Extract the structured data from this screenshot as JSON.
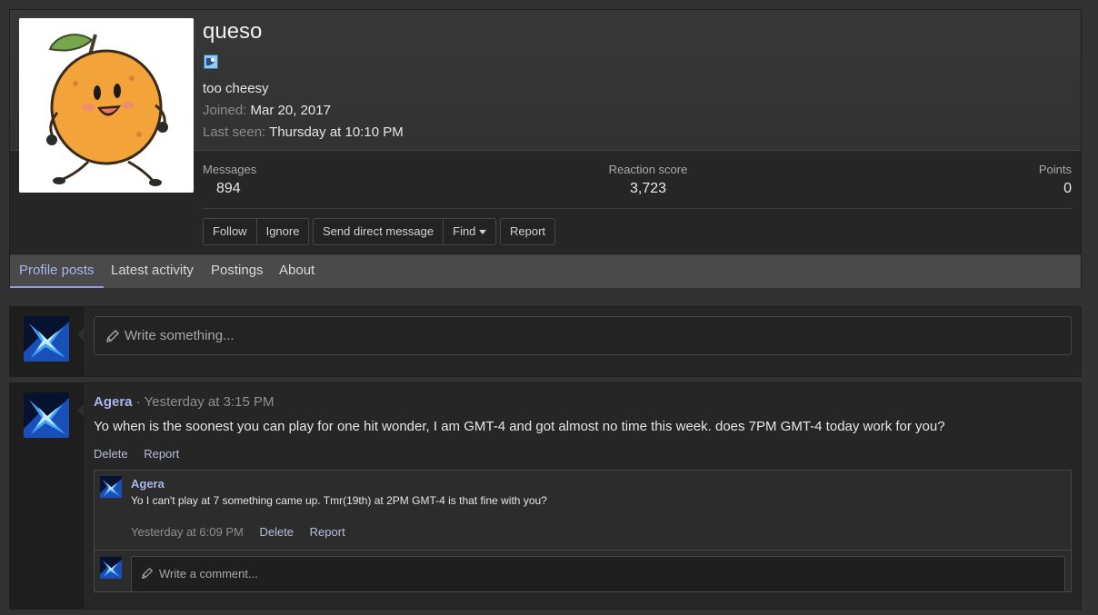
{
  "profile": {
    "username": "queso",
    "status": "too cheesy",
    "joined_label": "Joined:",
    "joined_value": "Mar 20, 2017",
    "last_seen_label": "Last seen:",
    "last_seen_value": "Thursday at 10:10 PM",
    "avatar_icon": "orange-mascot-icon"
  },
  "stats": {
    "messages_label": "Messages",
    "messages_value": "894",
    "reaction_label": "Reaction score",
    "reaction_value": "3,723",
    "points_label": "Points",
    "points_value": "0"
  },
  "buttons": {
    "follow": "Follow",
    "ignore": "Ignore",
    "send_dm": "Send direct message",
    "find": "Find",
    "report": "Report"
  },
  "tabs": [
    {
      "label": "Profile posts",
      "active": true
    },
    {
      "label": "Latest activity",
      "active": false
    },
    {
      "label": "Postings",
      "active": false
    },
    {
      "label": "About",
      "active": false
    }
  ],
  "new_post": {
    "placeholder": "Write something..."
  },
  "post": {
    "author": "Agera",
    "timestamp": "· Yesterday at 3:15 PM",
    "body": "Yo when is the soonest you can play for one hit wonder, I am GMT-4 and got almost no time this week. does 7PM GMT-4 today work for you?",
    "delete_label": "Delete",
    "report_label": "Report"
  },
  "comment": {
    "author": "Agera",
    "body": "Yo I can't play at 7 something came up. Tmr(19th) at 2PM GMT-4 is that fine with you?",
    "timestamp": "Yesterday at 6:09 PM",
    "delete_label": "Delete",
    "report_label": "Report"
  },
  "reply": {
    "placeholder": "Write a comment..."
  },
  "colors": {
    "accent": "#a9b6ee",
    "background": "#323232",
    "panel": "#262626"
  }
}
